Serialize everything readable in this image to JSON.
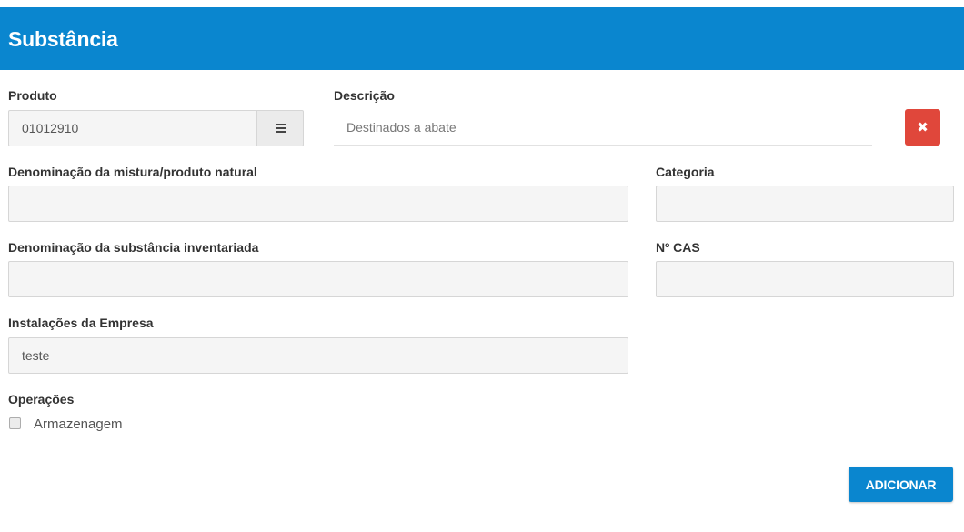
{
  "header": {
    "title": "Substância"
  },
  "produto": {
    "label": "Produto",
    "value": "01012910"
  },
  "descricao": {
    "label": "Descrição",
    "placeholder": "Destinados a abate"
  },
  "denominacao_mistura": {
    "label": "Denominação da mistura/produto natural",
    "value": ""
  },
  "categoria": {
    "label": "Categoria",
    "value": ""
  },
  "denominacao_substancia": {
    "label": "Denominação da substância inventariada",
    "value": ""
  },
  "cas": {
    "label": "Nº CAS",
    "value": ""
  },
  "instalacoes": {
    "label": "Instalações da Empresa",
    "value": "teste"
  },
  "operacoes": {
    "label": "Operações",
    "options": [
      {
        "label": "Armazenagem",
        "checked": false
      }
    ]
  },
  "actions": {
    "add_label": "ADICIONAR",
    "clear_icon": "✖"
  },
  "icons": {
    "menu": "hamburger-icon",
    "clear": "close-icon"
  },
  "colors": {
    "primary": "#0a86cf",
    "danger": "#e0473b"
  }
}
